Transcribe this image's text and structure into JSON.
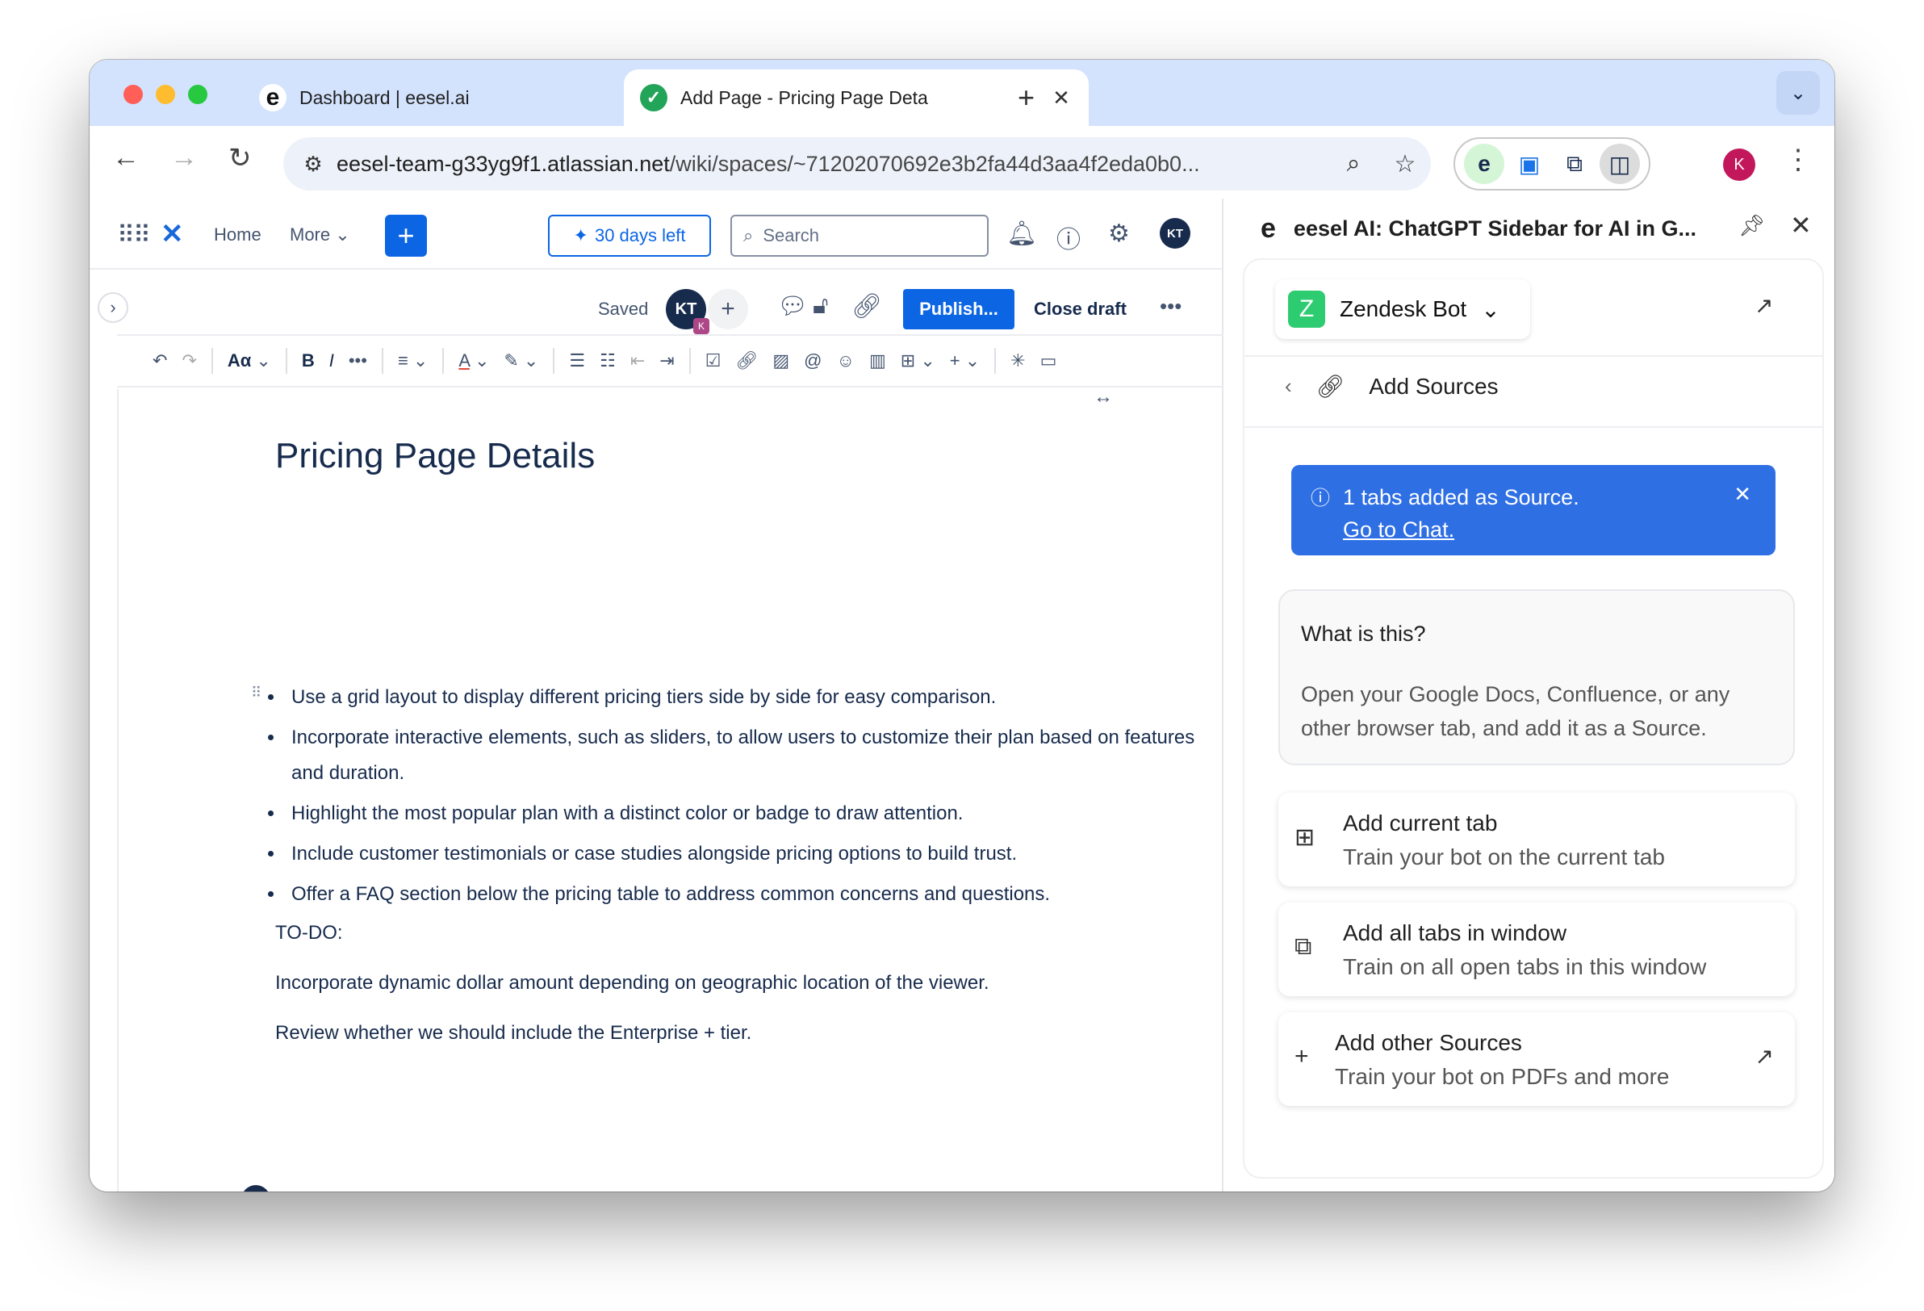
{
  "browser": {
    "tabs": [
      {
        "title": "Dashboard | eesel.ai",
        "favicon": "e"
      },
      {
        "title": "Add Page - Pricing Page Deta",
        "favicon": "check"
      }
    ],
    "url": {
      "host": "eesel-team-g33yg9f1.atlassian.net",
      "path": "/wiki/spaces/~71202070692e3b2fa44d3aa4f2eda0b0..."
    },
    "profile_initial": "K"
  },
  "confluence": {
    "nav": {
      "home": "Home",
      "more": "More",
      "trial": "30 days left",
      "search_placeholder": "Search",
      "avatar": "KT"
    },
    "actions": {
      "saved": "Saved",
      "collaborator": "KT",
      "collaborator_badge": "K",
      "publish": "Publish...",
      "close_draft": "Close draft"
    },
    "toolbar": {
      "text_style": "Aα"
    },
    "page": {
      "title": "Pricing Page Details",
      "bullets": [
        "Use a grid layout to display different pricing tiers side by side for easy comparison.",
        "Incorporate interactive elements, such as sliders, to allow users to customize their plan based on features and duration.",
        "Highlight the most popular plan with a distinct color or badge to draw attention.",
        "Include customer testimonials or case studies alongside pricing options to build trust.",
        "Offer a FAQ section below the pricing table to address common concerns and questions."
      ],
      "todo_label": "TO-DO:",
      "para1": "Incorporate dynamic dollar amount depending on geographic location of the viewer.",
      "para2": "Review whether we should include the Enterprise + tier."
    }
  },
  "sidebar": {
    "title": "eesel AI: ChatGPT Sidebar for AI in G...",
    "bot": {
      "initial": "Z",
      "name": "Zendesk Bot"
    },
    "section": "Add Sources",
    "notice": {
      "text": "1 tabs added as Source.",
      "link": "Go to Chat."
    },
    "whatis": {
      "heading": "What is this?",
      "body": "Open your Google Docs, Confluence, or any other browser tab, and add it as a Source."
    },
    "cards": [
      {
        "title": "Add current tab",
        "subtitle": "Train your bot on the current tab"
      },
      {
        "title": "Add all tabs in window",
        "subtitle": "Train on all open tabs in this window"
      },
      {
        "title": "Add other Sources",
        "subtitle": "Train your bot on PDFs and more"
      }
    ]
  },
  "colors": {
    "accent": "#0c66e4",
    "notice": "#2f6fe4",
    "tabstrip": "#d3e3fd",
    "bot_badge": "#2ecc71"
  }
}
